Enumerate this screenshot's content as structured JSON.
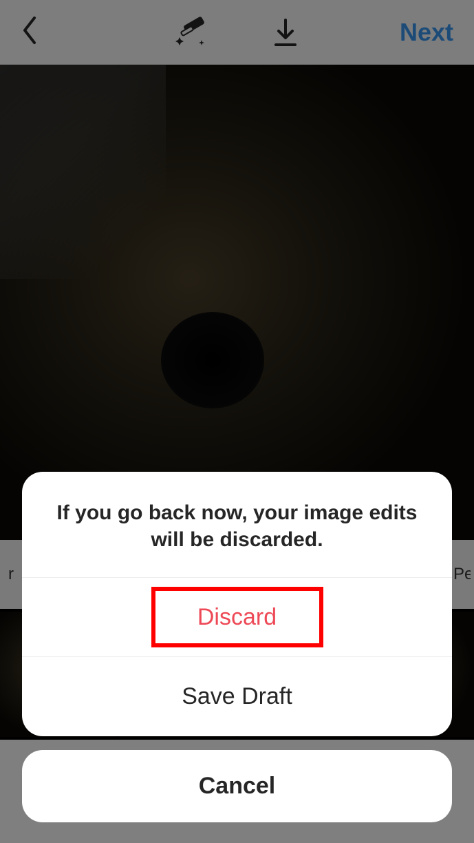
{
  "header": {
    "next_label": "Next"
  },
  "modal": {
    "message": "If you go back now, your image edits will be discarded.",
    "discard_label": "Discard",
    "save_draft_label": "Save Draft",
    "cancel_label": "Cancel"
  },
  "filters": {
    "partial_left": "r",
    "partial_right": "Pe"
  },
  "icons": {
    "back": "back-chevron-icon",
    "magic_wand": "magic-wand-icon",
    "download": "download-icon"
  },
  "colors": {
    "accent": "#3897f0",
    "destructive": "#ed4956",
    "highlight": "#ff0000"
  }
}
